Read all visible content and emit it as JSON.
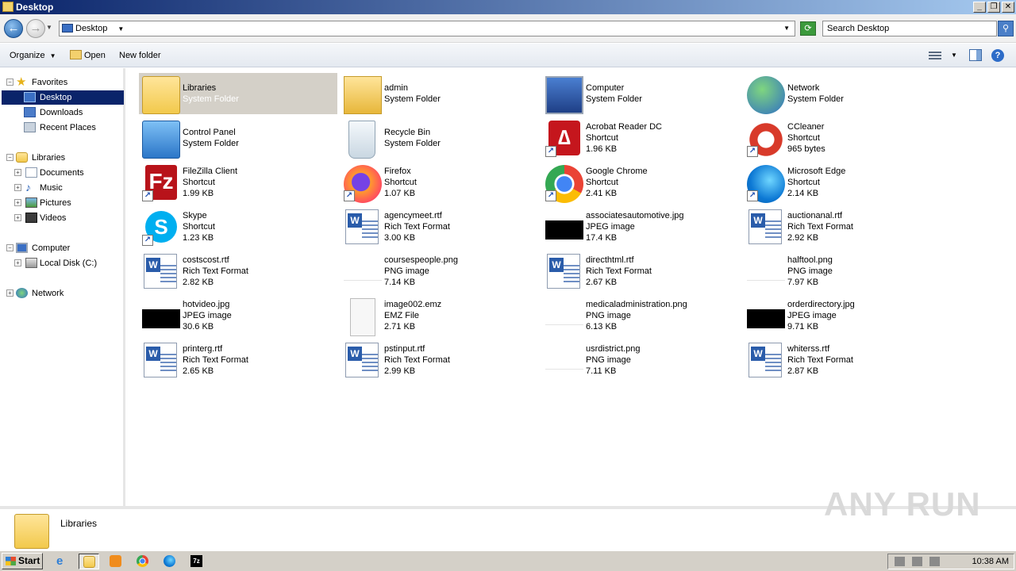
{
  "window": {
    "title": "Desktop",
    "minimize": "_",
    "maximize": "❐",
    "close": "✕"
  },
  "address": {
    "location": "Desktop",
    "search_placeholder": "Search Desktop"
  },
  "toolbar": {
    "organize": "Organize",
    "open": "Open",
    "new_folder": "New folder"
  },
  "nav": {
    "favorites": "Favorites",
    "desktop": "Desktop",
    "downloads": "Downloads",
    "recent_places": "Recent Places",
    "libraries": "Libraries",
    "documents": "Documents",
    "music": "Music",
    "pictures": "Pictures",
    "videos": "Videos",
    "computer": "Computer",
    "local_disk": "Local Disk (C:)",
    "network": "Network"
  },
  "items": [
    {
      "name": "Libraries",
      "line2": "System Folder",
      "line3": "",
      "icon": "library-folder-icon"
    },
    {
      "name": "admin",
      "line2": "System Folder",
      "line3": "",
      "icon": "user-folder-icon"
    },
    {
      "name": "Computer",
      "line2": "System Folder",
      "line3": "",
      "icon": "computer-icon"
    },
    {
      "name": "Network",
      "line2": "System Folder",
      "line3": "",
      "icon": "network-icon"
    },
    {
      "name": "Control Panel",
      "line2": "System Folder",
      "line3": "",
      "icon": "control-panel-icon"
    },
    {
      "name": "Recycle Bin",
      "line2": "System Folder",
      "line3": "",
      "icon": "recycle-bin-icon"
    },
    {
      "name": "Acrobat Reader DC",
      "line2": "Shortcut",
      "line3": "1.96 KB",
      "icon": "acrobat-icon"
    },
    {
      "name": "CCleaner",
      "line2": "Shortcut",
      "line3": "965 bytes",
      "icon": "ccleaner-icon"
    },
    {
      "name": "FileZilla Client",
      "line2": "Shortcut",
      "line3": "1.99 KB",
      "icon": "filezilla-icon"
    },
    {
      "name": "Firefox",
      "line2": "Shortcut",
      "line3": "1.07 KB",
      "icon": "firefox-icon"
    },
    {
      "name": "Google Chrome",
      "line2": "Shortcut",
      "line3": "2.41 KB",
      "icon": "chrome-icon"
    },
    {
      "name": "Microsoft Edge",
      "line2": "Shortcut",
      "line3": "2.14 KB",
      "icon": "edge-icon"
    },
    {
      "name": "Skype",
      "line2": "Shortcut",
      "line3": "1.23 KB",
      "icon": "skype-icon"
    },
    {
      "name": "agencymeet.rtf",
      "line2": "Rich Text Format",
      "line3": "3.00 KB",
      "icon": "rtf-document-icon"
    },
    {
      "name": "associatesautomotive.jpg",
      "line2": "JPEG image",
      "line3": "17.4 KB",
      "icon": "jpeg-thumbnail-icon"
    },
    {
      "name": "auctionanal.rtf",
      "line2": "Rich Text Format",
      "line3": "2.92 KB",
      "icon": "rtf-document-icon"
    },
    {
      "name": "costscost.rtf",
      "line2": "Rich Text Format",
      "line3": "2.82 KB",
      "icon": "rtf-document-icon"
    },
    {
      "name": "coursespeople.png",
      "line2": "PNG image",
      "line3": "7.14 KB",
      "icon": "png-thumbnail-icon"
    },
    {
      "name": "directhtml.rtf",
      "line2": "Rich Text Format",
      "line3": "2.67 KB",
      "icon": "rtf-document-icon"
    },
    {
      "name": "halftool.png",
      "line2": "PNG image",
      "line3": "7.97 KB",
      "icon": "png-thumbnail-icon"
    },
    {
      "name": "hotvideo.jpg",
      "line2": "JPEG image",
      "line3": "30.6 KB",
      "icon": "jpeg-thumbnail-icon"
    },
    {
      "name": "image002.emz",
      "line2": "EMZ File",
      "line3": "2.71 KB",
      "icon": "emz-file-icon"
    },
    {
      "name": "medicaladministration.png",
      "line2": "PNG image",
      "line3": "6.13 KB",
      "icon": "png-thumbnail-icon"
    },
    {
      "name": "orderdirectory.jpg",
      "line2": "JPEG image",
      "line3": "9.71 KB",
      "icon": "jpeg-thumbnail-icon"
    },
    {
      "name": "printerg.rtf",
      "line2": "Rich Text Format",
      "line3": "2.65 KB",
      "icon": "rtf-document-icon"
    },
    {
      "name": "pstinput.rtf",
      "line2": "Rich Text Format",
      "line3": "2.99 KB",
      "icon": "rtf-document-icon"
    },
    {
      "name": "usrdistrict.png",
      "line2": "PNG image",
      "line3": "7.11 KB",
      "icon": "png-thumbnail-icon"
    },
    {
      "name": "whiterss.rtf",
      "line2": "Rich Text Format",
      "line3": "2.87 KB",
      "icon": "rtf-document-icon"
    }
  ],
  "details": {
    "selected_name": "Libraries"
  },
  "watermark": "ANY RUN",
  "taskbar": {
    "start": "Start",
    "clock": "10:38 AM"
  }
}
